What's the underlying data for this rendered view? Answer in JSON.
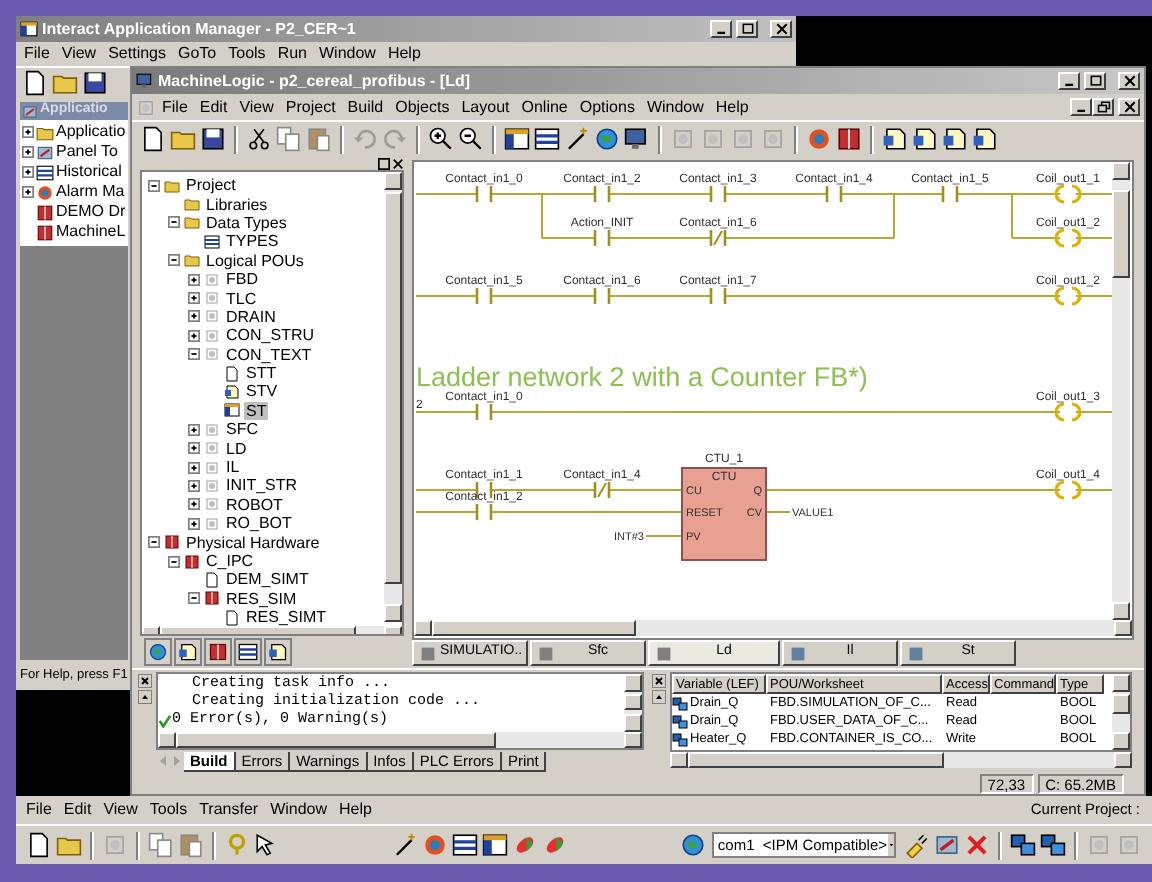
{
  "back_window": {
    "title": "Interact Application Manager - P2_CER~1",
    "menu": [
      "File",
      "View",
      "Settings",
      "GoTo",
      "Tools",
      "Run",
      "Window",
      "Help"
    ],
    "pane_title": "Applicatio",
    "tree": [
      {
        "label": "Applicatio",
        "kind": "folder",
        "expanded": false
      },
      {
        "label": "Panel To",
        "kind": "panel",
        "expanded": false
      },
      {
        "label": "Historical",
        "kind": "chart",
        "expanded": false
      },
      {
        "label": "Alarm Ma",
        "kind": "alarm",
        "expanded": false
      },
      {
        "label": "DEMO Dr",
        "kind": "driver"
      },
      {
        "label": "MachineL",
        "kind": "driver"
      }
    ],
    "status": "For Help, press F1"
  },
  "main_window": {
    "title": "MachineLogic - p2_cereal_profibus - [Ld]",
    "menu": [
      "File",
      "Edit",
      "View",
      "Project",
      "Build",
      "Objects",
      "Layout",
      "Online",
      "Options",
      "Window",
      "Help"
    ],
    "project_tree": [
      {
        "label": "Project",
        "kind": "folder",
        "expanded": true,
        "selected": false,
        "children": [
          {
            "label": "Libraries",
            "kind": "folder",
            "selected": false
          },
          {
            "label": "Data Types",
            "kind": "folder",
            "expanded": true,
            "selected": false,
            "children": [
              {
                "label": "TYPES",
                "kind": "types",
                "selected": false
              }
            ]
          },
          {
            "label": "Logical POUs",
            "kind": "folder",
            "expanded": true,
            "selected": false,
            "children": [
              {
                "label": "FBD",
                "kind": "pou",
                "expanded": false,
                "selected": false
              },
              {
                "label": "TLC",
                "kind": "pou",
                "expanded": false,
                "selected": false
              },
              {
                "label": "DRAIN",
                "kind": "pou",
                "expanded": false,
                "selected": false
              },
              {
                "label": "CON_STRU",
                "kind": "pou",
                "expanded": false,
                "selected": false
              },
              {
                "label": "CON_TEXT",
                "kind": "pou",
                "expanded": true,
                "selected": false,
                "children": [
                  {
                    "label": "STT",
                    "kind": "info",
                    "selected": false
                  },
                  {
                    "label": "STV",
                    "kind": "vars",
                    "selected": false
                  },
                  {
                    "label": "ST",
                    "kind": "sheet",
                    "selected": true
                  }
                ]
              },
              {
                "label": "SFC",
                "kind": "pou",
                "expanded": false,
                "selected": false
              },
              {
                "label": "LD",
                "kind": "pou",
                "expanded": false,
                "selected": false
              },
              {
                "label": "IL",
                "kind": "pou",
                "expanded": false,
                "selected": false
              },
              {
                "label": "INIT_STR",
                "kind": "pou",
                "expanded": false,
                "selected": false
              },
              {
                "label": "ROBOT",
                "kind": "pou",
                "expanded": false,
                "selected": false
              },
              {
                "label": "RO_BOT",
                "kind": "pou",
                "expanded": false,
                "selected": false
              }
            ]
          }
        ]
      },
      {
        "label": "Physical Hardware",
        "kind": "hardware",
        "expanded": true,
        "selected": false,
        "children": [
          {
            "label": "C_IPC",
            "kind": "hardware",
            "expanded": true,
            "selected": false,
            "children": [
              {
                "label": "DEM_SIMT",
                "kind": "info",
                "selected": false
              },
              {
                "label": "RES_SIM",
                "kind": "hardware",
                "expanded": true,
                "selected": false,
                "children": [
                  {
                    "label": "RES_SIMT",
                    "kind": "info",
                    "selected": false
                  }
                ]
              }
            ]
          }
        ]
      }
    ],
    "ladder": {
      "lines": [
        {
          "contacts": [
            {
              "label": "Contact_in1_0",
              "negated": false
            },
            {
              "label": "Contact_in1_2",
              "negated": false
            },
            {
              "label": "Contact_in1_3",
              "negated": false
            },
            {
              "label": "Contact_in1_4",
              "negated": false
            },
            {
              "label": "Contact_in1_5",
              "negated": false
            }
          ],
          "coil": "Coil_out1_1"
        },
        {
          "contacts": [
            {
              "label": "Action_INIT",
              "negated": false
            },
            {
              "label": "Contact_in1_6",
              "negated": true
            }
          ],
          "coil": "Coil_out1_2"
        },
        {
          "contacts": [
            {
              "label": "Contact_in1_5",
              "negated": false
            },
            {
              "label": "Contact_in1_6",
              "negated": false
            },
            {
              "label": "Contact_in1_7",
              "negated": false
            }
          ],
          "coil": "Coil_out1_2"
        },
        {
          "contacts": [
            {
              "label": "Contact_in1_0",
              "negated": false
            }
          ],
          "coil": "Coil_out1_3"
        },
        {
          "contacts": [
            {
              "label": "Contact_in1_1",
              "negated": false
            },
            {
              "label": "Contact_in1_4",
              "negated": true
            }
          ],
          "coil": "Coil_out1_4"
        },
        {
          "contacts": [
            {
              "label": "Contact_in1_2",
              "negated": false
            }
          ]
        }
      ],
      "comment": "Ladder network 2 with a Counter FB*)",
      "network_label": "2",
      "block": {
        "instance": "CTU_1",
        "type": "CTU",
        "inputs": [
          "CU",
          "RESET",
          "PV"
        ],
        "outputs": [
          "Q",
          "CV"
        ],
        "preset": "INT#3",
        "output_variable": "VALUE1"
      }
    },
    "editor_tabs": [
      {
        "label": "SIMULATIO..",
        "selected": false
      },
      {
        "label": "Sfc",
        "selected": false
      },
      {
        "label": "Ld",
        "selected": true
      },
      {
        "label": "Il",
        "selected": false
      },
      {
        "label": "St",
        "selected": false
      }
    ],
    "output": {
      "lines": [
        {
          "text": "Creating task info ...",
          "kind": "info"
        },
        {
          "text": "Creating initialization code ...",
          "kind": "info"
        },
        {
          "text": "0 Error(s), 0 Warning(s)",
          "kind": "success"
        }
      ],
      "tabs": [
        {
          "label": "Build",
          "selected": true
        },
        {
          "label": "Errors",
          "selected": false
        },
        {
          "label": "Warnings",
          "selected": false
        },
        {
          "label": "Infos",
          "selected": false
        },
        {
          "label": "PLC Errors",
          "selected": false
        },
        {
          "label": "Print",
          "selected": false
        }
      ]
    },
    "variables": {
      "columns": [
        "Variable (LEF)",
        "POU/Worksheet",
        "Access",
        "Command",
        "Type"
      ],
      "rows": [
        {
          "variable": "Drain_Q",
          "pou": "FBD.SIMULATION_OF_C...",
          "access": "Read",
          "type": "BOOL"
        },
        {
          "variable": "Drain_Q",
          "pou": "FBD.USER_DATA_OF_C...",
          "access": "Read",
          "type": "BOOL"
        },
        {
          "variable": "Heater_Q",
          "pou": "FBD.CONTAINER_IS_CO...",
          "access": "Write",
          "type": "BOOL"
        }
      ]
    },
    "status": [
      "72,33",
      "C: 65.2MB"
    ]
  },
  "bottom_app": {
    "menu": [
      "File",
      "Edit",
      "View",
      "Tools",
      "Transfer",
      "Window",
      "Help"
    ],
    "current_project": "Current Project :",
    "port": "com1  <IPM Compatible>"
  }
}
